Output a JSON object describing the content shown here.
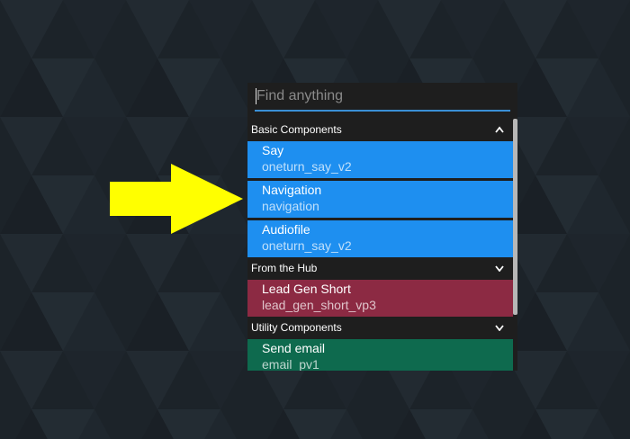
{
  "search": {
    "placeholder": "Find anything",
    "value": ""
  },
  "colors": {
    "basic": "#1e8ff0",
    "hub": "#8c2a43",
    "utility": "#0e6a4e",
    "accent": "#3a8fd6",
    "arrow": "#ffff00"
  },
  "sections": [
    {
      "label": "Basic Components",
      "state": "expanded",
      "icon": "chevron-up-icon",
      "items": [
        {
          "title": "Say",
          "subtitle": "oneturn_say_v2"
        },
        {
          "title": "Navigation",
          "subtitle": "navigation"
        },
        {
          "title": "Audiofile",
          "subtitle": "oneturn_say_v2"
        }
      ]
    },
    {
      "label": "From the Hub",
      "state": "collapsed",
      "icon": "chevron-down-icon",
      "items": [
        {
          "title": "Lead Gen Short",
          "subtitle": "lead_gen_short_vp3"
        }
      ]
    },
    {
      "label": "Utility Components",
      "state": "collapsed",
      "icon": "chevron-down-icon",
      "items": [
        {
          "title": "Send email",
          "subtitle": "email_pv1"
        }
      ]
    }
  ],
  "annotation": {
    "icon": "arrow-right-icon"
  }
}
